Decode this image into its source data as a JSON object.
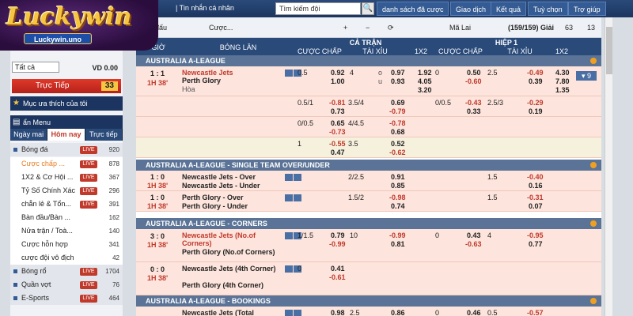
{
  "topbar": {
    "personal_msg": "| Tin nhắn cá nhân",
    "search_placeholder": "Tìm kiếm đội",
    "nav": [
      "danh sách đã cược",
      "Giao dịch",
      "Kết quả",
      "Tuỳ chọn",
      "Trợ giúp"
    ]
  },
  "logo": {
    "brand": "Luckywin",
    "url": "Luckywin.uno"
  },
  "sidebar": {
    "select": "Tất cả",
    "money": "VD 0.00",
    "live_label": "Trực Tiếp",
    "live_count": "33",
    "favorites": "Mục ưa thích của tôi",
    "menu": "ẩn Menu",
    "tabs": [
      "Ngày mai",
      "Hôm nay",
      "Trực tiếp"
    ],
    "sports": [
      {
        "name": "Bóng đá",
        "live": "LIVE",
        "count": "920"
      },
      {
        "name": "Cược chấp ...",
        "live": "LIVE",
        "count": "878"
      },
      {
        "name": "1X2 & Cơ Hội ...",
        "live": "LIVE",
        "count": "367"
      },
      {
        "name": "Tỷ Số Chính Xác",
        "live": "LIVE",
        "count": "296"
      },
      {
        "name": "chẵn lẻ & Tổn...",
        "live": "LIVE",
        "count": "391"
      },
      {
        "name": "Bàn đầu/Bàn ...",
        "live": "",
        "count": "162"
      },
      {
        "name": "Nửa trận / Toà...",
        "live": "",
        "count": "140"
      },
      {
        "name": "Cược hỗn hợp",
        "live": "",
        "count": "341"
      },
      {
        "name": "cược đội vô địch",
        "live": "",
        "count": "42"
      },
      {
        "name": "Bóng rổ",
        "live": "LIVE",
        "count": "1704"
      },
      {
        "name": "Quần vợt",
        "live": "LIVE",
        "count": "76"
      },
      {
        "name": "E-Sports",
        "live": "LIVE",
        "count": "464"
      }
    ]
  },
  "toolbar": {
    "left": "c cặp đấu",
    "bet": "Cược...",
    "odds_type": "Mã Lai",
    "count": "(159/159) Giải",
    "b1": "63",
    "b2": "13"
  },
  "header": {
    "time": "GIỜ",
    "match": "BÓNG LĂN",
    "full": "CẢ TRẬN",
    "half": "HIỆP 1",
    "handicap": "CƯỢC CHẤP",
    "ou": "TÀI XỈU",
    "x12": "1X2"
  },
  "leagues": [
    "AUSTRALIA A-LEAGUE",
    "AUSTRALIA A-LEAGUE - SINGLE TEAM OVER/UNDER",
    "AUSTRALIA A-LEAGUE - CORNERS",
    "AUSTRALIA A-LEAGUE - BOOKINGS"
  ],
  "matches": {
    "m1": {
      "score": "1 : 1",
      "time": "1H 38'",
      "home": "Newcastle Jets",
      "away": "Perth Glory",
      "draw": "Hòa",
      "h1": "0.5",
      "o1a": "0.92",
      "o1b": "1.00",
      "ou1": "4",
      "ou1o": "o",
      "ou1u": "u",
      "ou1a": "0.97",
      "ou1b": "0.93",
      "x1": "1.92",
      "x2": "4.05",
      "x3": "3.20",
      "hh": "0",
      "ho1": "0.50",
      "ho2": "-0.60",
      "hou": "2.5",
      "hou1": "-0.49",
      "hou2": "0.39",
      "hx1": "4.30",
      "hx2": "7.80",
      "hx3": "1.35",
      "more": "9"
    },
    "m1r2": {
      "h": "0.5/1",
      "a": "-0.81",
      "b": "0.73",
      "ou": "3.5/4",
      "oua": "0.69",
      "oub": "-0.79",
      "hh": "0/0.5",
      "h1": "-0.43",
      "h2": "0.33",
      "hou": "2.5/3",
      "hou1": "-0.29",
      "hou2": "0.19"
    },
    "m1r3": {
      "h": "0/0.5",
      "a": "0.65",
      "b": "-0.73",
      "ou": "4/4.5",
      "oua": "-0.78",
      "oub": "0.68"
    },
    "m1r4": {
      "h": "1",
      "a": "-0.55",
      "b": "0.47",
      "ou": "3.5",
      "oua": "0.52",
      "oub": "-0.62"
    },
    "m2": {
      "score": "1 : 0",
      "time": "1H 38'",
      "home": "Newcastle Jets - Over",
      "away": "Newcastle Jets - Under",
      "ou": "2/2.5",
      "a": "0.91",
      "b": "0.85",
      "hou": "1.5",
      "h1": "-0.40",
      "h2": "0.16"
    },
    "m3": {
      "score": "1 : 0",
      "time": "1H 38'",
      "home": "Perth Glory - Over",
      "away": "Perth Glory - Under",
      "ou": "1.5/2",
      "a": "-0.98",
      "b": "0.74",
      "hou": "1.5",
      "h1": "-0.31",
      "h2": "0.07"
    },
    "m4": {
      "score": "3 : 0",
      "time": "1H 38'",
      "home": "Newcastle Jets (No.of Corners)",
      "away": "Perth Glory (No.of Corners)",
      "h": "1/1.5",
      "a": "0.79",
      "b": "-0.99",
      "ou": "10",
      "oua": "-0.99",
      "oub": "0.81",
      "hh": "0",
      "h1": "0.43",
      "h2": "-0.63",
      "hou": "4",
      "hou1": "-0.95",
      "hou2": "0.77"
    },
    "m5": {
      "score": "0 : 0",
      "time": "1H 38'",
      "home": "Newcastle Jets (4th Corner)",
      "away": "Perth Glory (4th Corner)",
      "h": "0",
      "a": "0.41",
      "b": "-0.61"
    },
    "m6": {
      "home": "Newcastle Jets (Total",
      "a": "0.98",
      "ou": "2.5",
      "oua": "0.86",
      "hh": "0",
      "h1": "0.46",
      "hou": "0.5",
      "hou1": "-0.57"
    }
  }
}
